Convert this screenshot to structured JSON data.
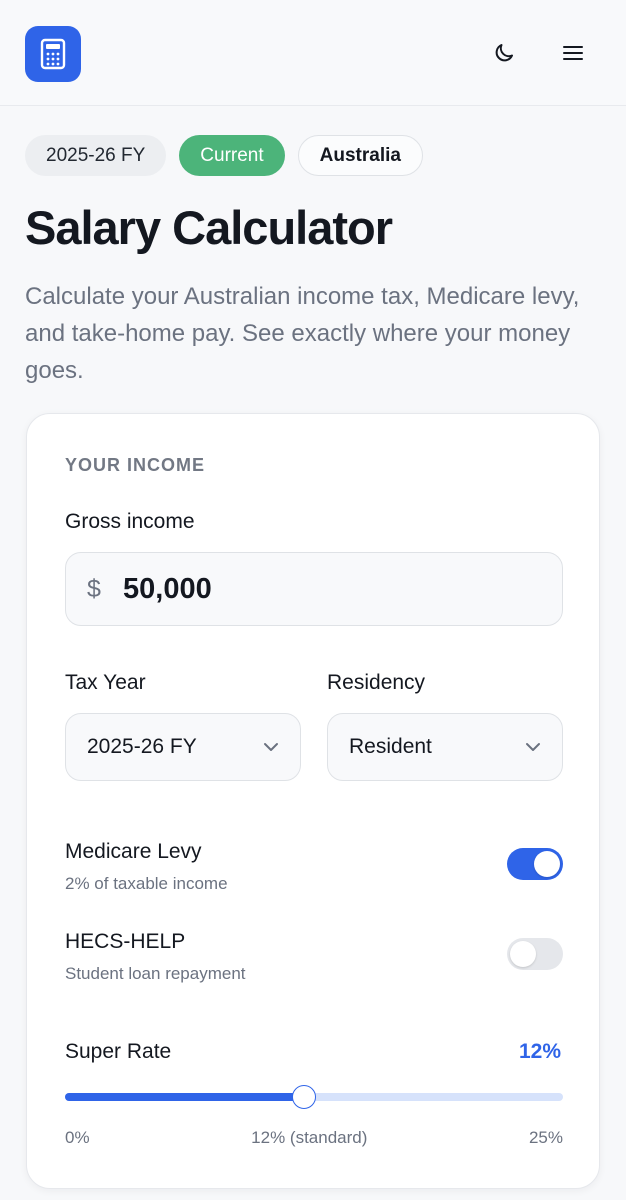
{
  "header": {
    "logo_icon": "calculator-icon",
    "theme_icon": "moon-icon",
    "menu_icon": "hamburger-menu-icon",
    "accent": "#2f64e8"
  },
  "chips": {
    "fiscal_year": "2025-26 FY",
    "status": "Current",
    "country": "Australia",
    "status_color": "#4cb47a"
  },
  "page": {
    "title": "Salary Calculator",
    "description": "Calculate your Australian income tax, Medicare levy, and take-home pay. See exactly where your money goes."
  },
  "income_card": {
    "section_label": "YOUR INCOME",
    "gross_income": {
      "label": "Gross income",
      "currency_symbol": "$",
      "value": "50,000"
    },
    "tax_year": {
      "label": "Tax Year",
      "selected": "2025-26 FY"
    },
    "residency": {
      "label": "Residency",
      "selected": "Resident"
    },
    "medicare_levy": {
      "title": "Medicare Levy",
      "subtitle": "2% of taxable income",
      "enabled": true
    },
    "hecs_help": {
      "title": "HECS-HELP",
      "subtitle": "Student loan repayment",
      "enabled": false
    },
    "super_rate": {
      "label": "Super Rate",
      "value_text": "12%",
      "value": 12,
      "min": 0,
      "max": 25,
      "min_label": "0%",
      "mid_label": "12% (standard)",
      "max_label": "25%"
    }
  }
}
